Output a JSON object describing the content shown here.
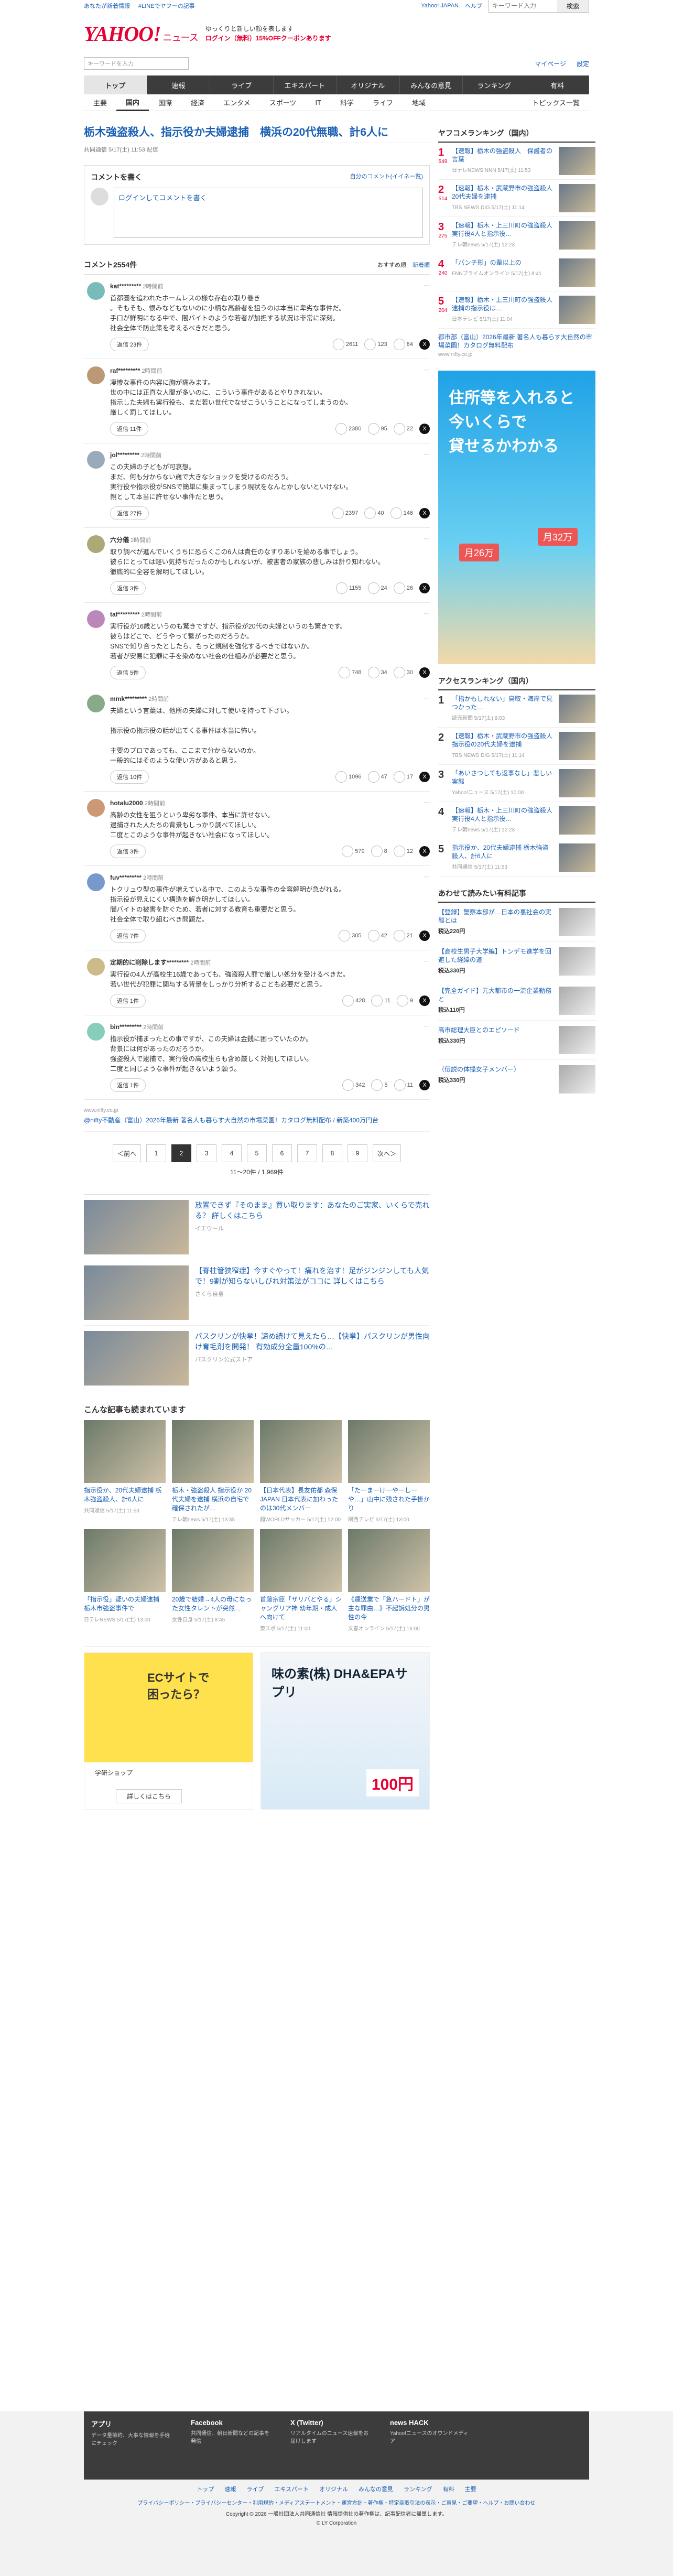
{
  "topbar": {
    "links": [
      "あなたが新着情報",
      "#LINEでヤフーの記事"
    ],
    "right": [
      "Yahoo! JAPAN",
      "ヘルプ"
    ],
    "search_placeholder": "キーワード入力",
    "search_button": "検索"
  },
  "header": {
    "logo": "YAHOO!",
    "logo_sub": "ニュース",
    "msg1": "ゆっくりと新しい顔を表します",
    "msg2": "ログイン（無料）15%OFFクーポンあります"
  },
  "search": {
    "placeholder": "キーワードを入力",
    "links": [
      "マイページ",
      "設定"
    ]
  },
  "nav1": [
    "トップ",
    "速報",
    "ライブ",
    "エキスパート",
    "オリジナル",
    "みんなの意見",
    "ランキング",
    "有料"
  ],
  "nav2": [
    "主要",
    "国内",
    "国際",
    "経済",
    "エンタメ",
    "スポーツ",
    "IT",
    "科学",
    "ライフ",
    "地域"
  ],
  "nav2_topics": "トピックス一覧",
  "article": {
    "title": "栃木強盗殺人、指示役か夫婦逮捕　横浜の20代無職、計6人に",
    "meta": "共同通信 5/17(土) 11:53 配信"
  },
  "comment_write": {
    "title": "コメントを書く",
    "link": "自分のコメント(イイネ一覧)",
    "input_placeholder": "ログインしてコメントを書く"
  },
  "comments_header": {
    "title": "コメント2554件",
    "sort": [
      "おすすめ順",
      "新着順"
    ]
  },
  "comments": [
    {
      "user": "kat*********",
      "time": "2時間前",
      "text": "首都圏を追われたホームレスの様な存在の取り巻き\n。そもそも、恨みなどもないのに小柄な高齢者を狙うのは本当に卑劣な事件だ。\n手口が鮮明になる中で、闇バイトのような若者が加担する状況は非常に深刻。\n社会全体で防止策を考えるべきだと思う。",
      "reply": "返信 23件",
      "good": "2611",
      "bad": "123",
      "avg": "84"
    },
    {
      "user": "raf*********",
      "time": "2時間前",
      "text": "凄惨な事件の内容に胸が痛みます。\n世の中には正直な人間が多いのに、こういう事件があるとやりきれない。\n指示した夫婦も実行役も、まだ若い世代でなぜこういうことになってしまうのか。\n厳しく罰してほしい。",
      "reply": "返信 11件",
      "good": "2380",
      "bad": "95",
      "avg": "22"
    },
    {
      "user": "jol*********",
      "time": "2時間前",
      "text": "この夫婦の子どもが可哀想。\nまだ、何も分からない歳で大きなショックを受けるのだろう。\n実行役や指示役がSNSで簡単に集まってしまう現状をなんとかしないといけない。\n親として本当に許せない事件だと思う。",
      "reply": "返信 27件",
      "good": "2397",
      "bad": "40",
      "avg": "146"
    },
    {
      "user": "六分儀",
      "time": "2時間前",
      "text": "取り調べが進んでいくうちに恐らくこの6人は責任のなすりあいを始める事でしょう。\n彼らにとっては軽い気持ちだったのかもしれないが、被害者の家族の悲しみは計り知れない。\n徹底的に全容を解明してほしい。",
      "reply": "返信 3件",
      "good": "1155",
      "bad": "24",
      "avg": "26"
    },
    {
      "user": "taf*********",
      "time": "2時間前",
      "text": "実行役が16歳というのも驚きですが、指示役が20代の夫婦というのも驚きです。\n彼らはどこで、どうやって繋がったのだろうか。\nSNSで知り合ったとしたら、もっと規制を強化するべきではないか。\n若者が安易に犯罪に手を染めない社会の仕組みが必要だと思う。",
      "reply": "返信 5件",
      "good": "748",
      "bad": "34",
      "avg": "30"
    },
    {
      "user": "mmk*********",
      "time": "2時間前",
      "text": "夫婦という言葉は、他所の夫婦に対して使いを持って下さい。\n\n指示役の指示役の話が出てくる事件は本当に怖い。\n\n主要のプロであっても、ここまで分からないのか。\n一般的にはそのような使い方があると思う。",
      "reply": "返信 10件",
      "good": "1096",
      "bad": "47",
      "avg": "17"
    },
    {
      "user": "hotalu2000",
      "time": "2時間前",
      "text": "高齢の女性を狙うという卑劣な事件、本当に許せない。\n逮捕された人たちの背景もしっかり調べてほしい。\n二度とこのような事件が起きない社会になってほしい。",
      "reply": "返信 3件",
      "good": "579",
      "bad": "8",
      "avg": "12"
    },
    {
      "user": "fuv*********",
      "time": "2時間前",
      "text": "トクリュウ型の事件が増えている中で、このような事件の全容解明が急がれる。\n指示役が見えにくい構造を解き明かしてほしい。\n闇バイトの被害を防ぐため、若者に対する教育も重要だと思う。\n社会全体で取り組むべき問題だ。",
      "reply": "返信 7件",
      "good": "305",
      "bad": "42",
      "avg": "21"
    },
    {
      "user": "定期的に削除します*********",
      "time": "2時間前",
      "text": "実行役の4人が高校生16歳であっても、強盗殺人罪で厳しい処分を受けるべきだ。\n若い世代が犯罪に関与する背景をしっかり分析することも必要だと思う。",
      "reply": "返信 1件",
      "good": "428",
      "bad": "11",
      "avg": "9"
    },
    {
      "user": "bin*********",
      "time": "2時間前",
      "text": "指示役が捕まったとの事ですが、この夫婦は金銭に困っていたのか。\n背景には何があったのだろうか。\n強盗殺人で逮捕で、実行役の高校生らも含め厳しく対処してほしい。\n二度と同じような事件が起きないよう願う。",
      "reply": "返信 1件",
      "good": "342",
      "bad": "5",
      "avg": "11"
    }
  ],
  "inline_ad": {
    "domain": "www.nifty.co.jp",
    "text": "@nifty不動産（富山）2026年最新 著名人も暮らす大自然の市場菜園！カタログ無料配布 / 新築400万円台"
  },
  "pager": {
    "prev": "＜前へ",
    "pages": [
      "1",
      "2",
      "3",
      "4",
      "5",
      "6",
      "7",
      "8",
      "9"
    ],
    "current": "2",
    "next": "次へ＞",
    "count": "11〜20件 / 1,969件"
  },
  "promos": [
    {
      "title": "放置できず『そのまま』買い取ります：あなたのご実家、いくらで売れる？ 詳しくはこちら",
      "src": "イエウール"
    },
    {
      "title": "【脊柱管狭窄症】今すぐやって！痛れを治す！足がジンジンしても人気で！9割が知らないしびれ対策法がココに 詳しくはこちら",
      "src": "さくら自身"
    },
    {
      "title": "パスクリンが快挙！諦め続けて見えたら…【快挙】パスクリンが男性向け育毛剤を開発！ 有効成分全量100%の…",
      "src": "パスクリン公式ストア"
    }
  ],
  "also": {
    "title": "こんな記事も読まれています",
    "items": [
      {
        "t": "指示役か、20代夫婦逮捕 栃木強盗殺人、計6人に",
        "s": "共同通信 5/17(土) 11:53"
      },
      {
        "t": "栃木・強盗殺人 指示役か 20代夫婦を逮捕 横浜の自宅で確保されたが…",
        "s": "テレ朝news 5/17(土) 13:35"
      },
      {
        "t": "【日本代表】長友佑都 森保JAPAN 日本代表に加わったのは30代メンバー",
        "s": "超WORLDサッカー 5/17(土) 12:00"
      },
      {
        "t": "「たーまーけーやーしーや…」山中に残された手掛かり",
        "s": "関西テレビ 5/17(土) 13:00"
      },
      {
        "t": "「指示役」疑いの夫婦逮捕 栃木市強盗事件で",
        "s": "日テレNEWS 5/17(土) 13:00"
      },
      {
        "t": "20歳で結婚→4人の母になった女性タレントが突然…",
        "s": "女性自身 5/17(土) 8:45"
      },
      {
        "t": "首藤宗臣「ザリバとやる」シャングリア神 幼年期・成人へ向けて",
        "s": "東スポ 5/17(土) 11:00"
      },
      {
        "t": "《運送業で「急ハードト」が主な罪由…》不起訴処分の男性の今",
        "s": "文春オンライン 5/17(土) 16:00"
      }
    ]
  },
  "bottom_ads": [
    {
      "title": "ECサイトで困ったら？",
      "brand": "学研ショップ",
      "link": "詳しくはこちら"
    },
    {
      "title": "味の素(株) DHA&EPAサプリ",
      "price": "100円",
      "brand": "味の素 公式"
    }
  ],
  "side": {
    "ranking_title": "ヤフコメランキング（国内）",
    "ranking": [
      {
        "n": "1",
        "t": "【速報】栃木の強盗殺人　保護者の言葉",
        "s": "日テレNEWS NNN 5/17(土) 11:53",
        "c": "549"
      },
      {
        "n": "2",
        "t": "【速報】栃木・武蔵野市の強盗殺人　20代夫婦を逮捕",
        "s": "TBS NEWS DIG 5/17(土) 11:14",
        "c": "514"
      },
      {
        "n": "3",
        "t": "【速報】栃木・上三川町の強盗殺人　実行役4人と指示役…",
        "s": "テレ朝news 5/17(土) 12:23",
        "c": "275"
      },
      {
        "n": "4",
        "t": "「パンチ形」の輩以上の",
        "s": "FNNプライムオンライン 5/17(土) 8:41",
        "c": "240"
      },
      {
        "n": "5",
        "t": "【速報】栃木・上三川町の強盗殺人　逮捕の指示役は…",
        "s": "日本テレビ 5/17(土) 11:04",
        "c": "204"
      }
    ],
    "pr": {
      "t": "都市部（富山）2026年最新 著名人も暮らす大自然の市場菜園！カタログ無料配布",
      "s": "www.nifty.co.jp"
    },
    "ad_text": [
      "住所等を入れると",
      "今いくらで",
      "貸せるかわかる"
    ],
    "ad_price1": "月26万",
    "ad_price2": "月32万",
    "access_title": "アクセスランキング（国内）",
    "access": [
      {
        "n": "1",
        "t": "「指かもしれない」鳥取・海岸で見つかった…",
        "s": "読売新聞 5/17(土) 9:03"
      },
      {
        "n": "2",
        "t": "【速報】栃木・武蔵野市の強盗殺人 指示役の20代夫婦を逮捕",
        "s": "TBS NEWS DIG 5/17(土) 11:14"
      },
      {
        "n": "3",
        "t": "「あいさつしても返事なし」悲しい実態",
        "s": "Yahoo!ニュース 5/17(土) 10:00"
      },
      {
        "n": "4",
        "t": "【速報】栃木・上三川町の強盗殺人 実行役4人と指示役…",
        "s": "テレ朝news 5/17(土) 12:23"
      },
      {
        "n": "5",
        "t": "指示役か、20代夫婦逮捕 栃木強盗殺人、計6人に",
        "s": "共同通信 5/17(土) 11:53"
      }
    ],
    "paypay_title": "あわせて読みたい有料記事",
    "paypay": [
      {
        "t": "【登録】警察本部が…日本の裏社会の実態とは",
        "p": "税込220円"
      },
      {
        "t": "【高校生男子大学編】トンデモ進学を回避した経緯の道",
        "p": "税込330円"
      },
      {
        "t": "【完全ガイド】元大都市の一流企業勤務と",
        "p": "税込110円"
      },
      {
        "t": "高市総理大臣とのエピソード",
        "p": "税込330円"
      },
      {
        "t": "（伝説の体操女子メンバー）",
        "p": "税込330円"
      }
    ]
  },
  "footer": {
    "blocks": [
      {
        "h": "アプリ",
        "p": "データ量節約、大事な情報を手軽にチェック"
      },
      {
        "h": "Facebook",
        "p": "共同通信、朝日新聞などの記事を発信"
      },
      {
        "h": "X (Twitter)",
        "p": "リアルタイムのニュース速報をお届けします"
      },
      {
        "h": "news HACK",
        "p": "Yahoo!ニュースのオウンドメディア"
      }
    ],
    "links": [
      "トップ",
      "速報",
      "ライブ",
      "エキスパート",
      "オリジナル",
      "みんなの意見",
      "ランキング",
      "有料",
      "主要"
    ],
    "links2": "プライバシーポリシー・プライバシーセンター・利用規約・メディアステートメント・運営方針・著作権・特定商取引法の表示・ご意見・ご要望・ヘルプ・お問い合わせ",
    "copyright": "Copyright © 2026 一般社団法人共同通信社 情報提供社の著作権は、記事配信者に帰属します。",
    "copyright2": "© LY Corporation"
  }
}
